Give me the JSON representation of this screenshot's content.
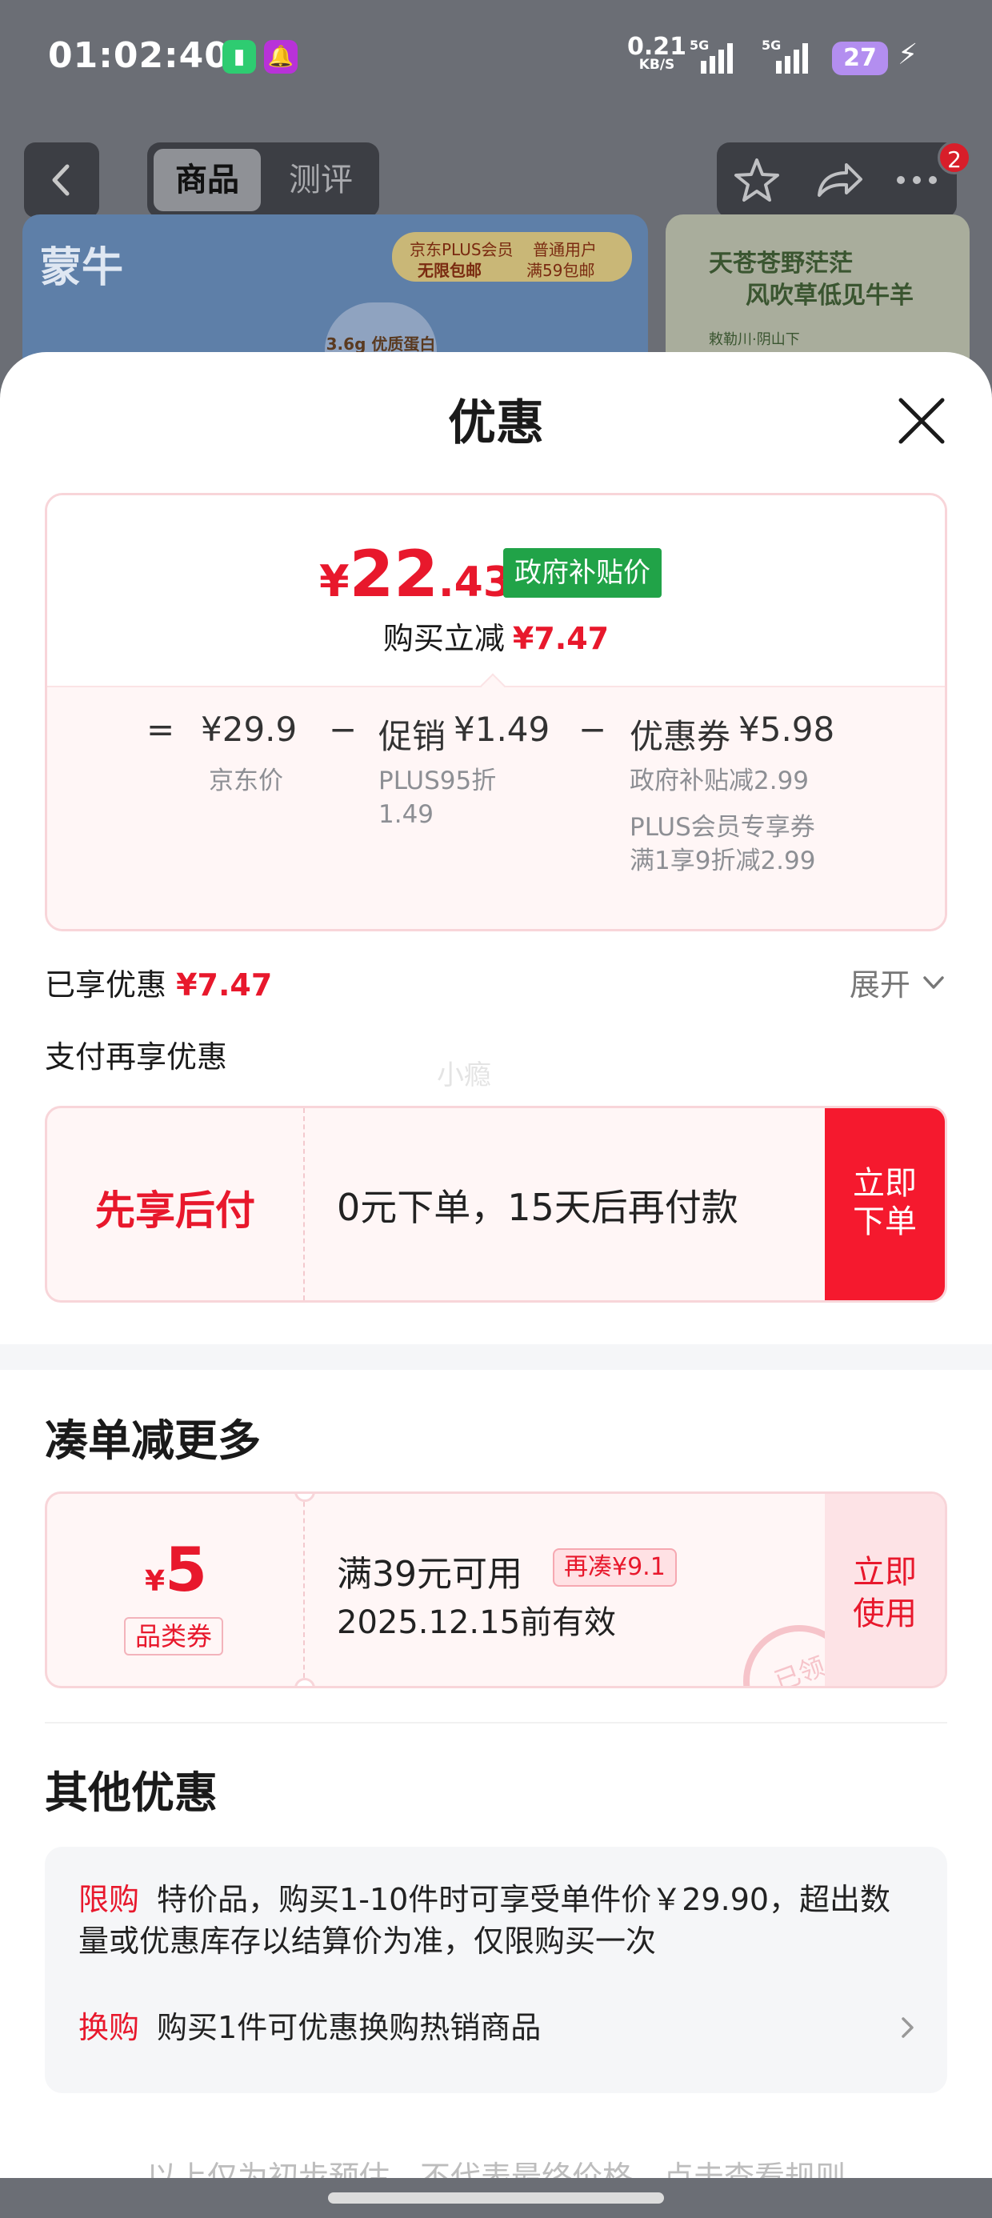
{
  "status_bar": {
    "time": "01:02:40",
    "net_rate": "0.21",
    "net_unit": "KB/S",
    "signal1_label": "5G",
    "signal2_label": "5G",
    "battery": "27",
    "app_icons": [
      "sim-app-icon",
      "notification-app-icon"
    ]
  },
  "product_header": {
    "tabs": [
      {
        "label": "商品",
        "active": true
      },
      {
        "label": "测评",
        "active": false
      }
    ],
    "badge_count": "2",
    "banner1": {
      "logo": "蒙牛",
      "tag_a": "京东PLUS会员",
      "tag_b": "无限包邮",
      "tag_c": "普通用户",
      "tag_d": "满59包邮",
      "bottle": "3.6g 优质蛋白"
    },
    "banner2": {
      "line1": "天苍苍野茫茫",
      "line2": "风吹草低见牛羊",
      "line3": "敕勒川·阴山下"
    }
  },
  "sheet": {
    "title": "优惠",
    "price_card": {
      "currency": "¥",
      "price_int": "22",
      "price_dec": ".43",
      "tag": "政府补贴价",
      "reduce_label": "购买立减",
      "reduce_value": "¥7.47",
      "equals": "=",
      "minus": "−",
      "jd_price_value": "¥29.9",
      "jd_price_label": "京东价",
      "promo_label": "促销",
      "promo_value": "¥1.49",
      "promo_detail_1": "PLUS95折",
      "promo_detail_2": "1.49",
      "coupon_label": "优惠券",
      "coupon_value": "¥5.98",
      "coupon_detail_1": "政府补贴减2.99",
      "coupon_detail_2": "PLUS会员专享券",
      "coupon_detail_3": "满1享9折减2.99"
    },
    "enjoyed_label": "已享优惠",
    "enjoyed_value": "¥7.47",
    "expand_label": "展开",
    "pay_more_label": "支付再享优惠",
    "watermark": "小瘾",
    "bnpl": {
      "title": "先享后付",
      "desc": "0元下单，15天后再付款",
      "button_line1": "立即",
      "button_line2": "下单"
    },
    "more_discount_title": "凑单减更多",
    "coupon": {
      "currency": "¥",
      "amount": "5",
      "type": "品类券",
      "condition": "满39元可用",
      "extra": "再凑¥9.1",
      "expiry": "2025.12.15前有效",
      "button_line1": "立即",
      "button_line2": "使用",
      "stamp": "已领"
    },
    "other_title": "其他优惠",
    "other_items": [
      {
        "label": "限购",
        "text": "特价品，购买1-10件时可享受单件价￥29.90，超出数量或优惠库存以结算价为准，仅限购买一次"
      },
      {
        "label": "换购",
        "text": "购买1件可优惠换购热销商品"
      }
    ],
    "footer_note": "以上仅为初步预估，不代表最终价格，点击查看规则"
  },
  "colors": {
    "accent_red": "#e8182c",
    "gov_green": "#21a348",
    "card_border": "#f8d5d9",
    "card_bg": "#fff6f6"
  }
}
